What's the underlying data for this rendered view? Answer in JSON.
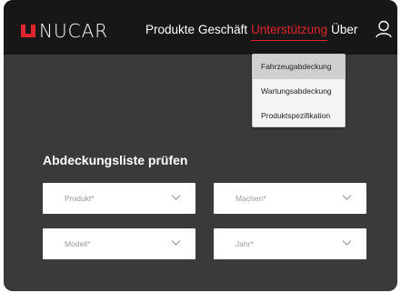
{
  "brand": {
    "name": "NUCAR",
    "accent": "#e1252f"
  },
  "nav": {
    "items": [
      "Produkte",
      "Geschäft",
      "Unterstützung",
      "Über"
    ],
    "active_index": 2,
    "user_icon": "user-icon"
  },
  "dropdown": {
    "items": [
      "Fahrzeugabdeckung",
      "Wartungsabdeckung",
      "Produktspezifikation"
    ],
    "highlighted_index": 0
  },
  "panel": {
    "title": "Abdeckungsliste prüfen",
    "fields": {
      "product": "Produkt*",
      "make": "Machen*",
      "model": "Modell*",
      "year": "Jahr*"
    },
    "dropdown_icon": "chevron-down-icon"
  }
}
